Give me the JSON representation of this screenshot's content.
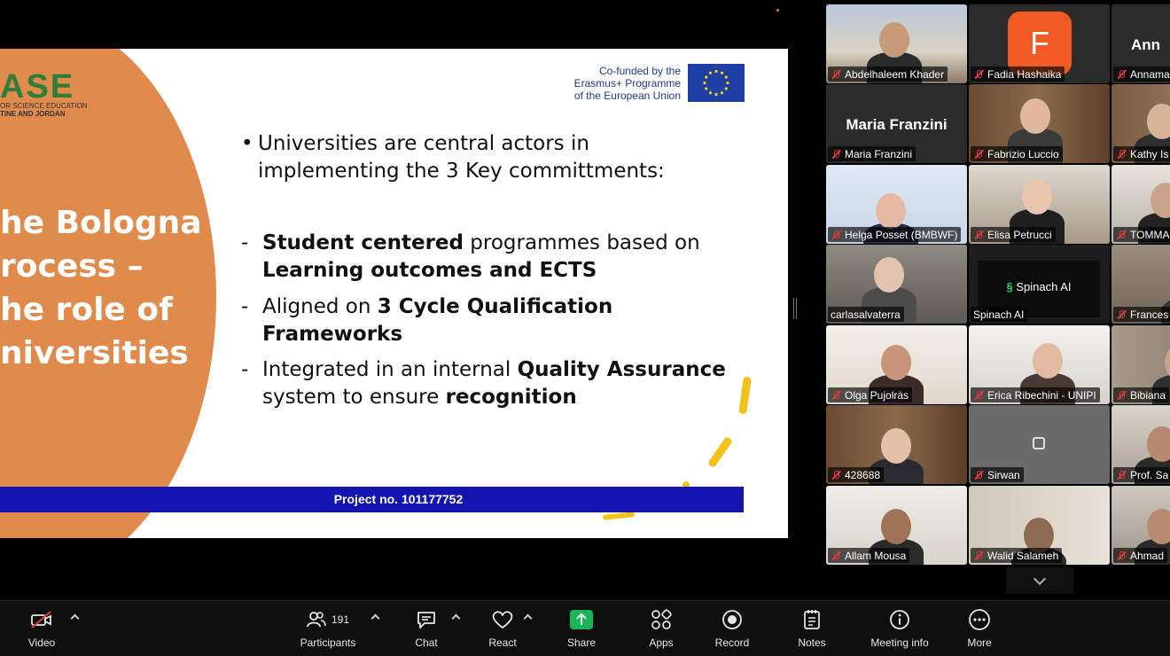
{
  "slide": {
    "logo_word": "ASE",
    "logo_line1": "OR SCIENCE EDUCATION",
    "logo_line2": "TINE AND JORDAN",
    "title": "he Bologna\nrocess –\nhe role of\nniversities",
    "eu_text": "Co-funded by the\nErasmus+ Programme\nof the European Union",
    "bullet_main": "Universities are central actors in implementing the 3 Key committments:",
    "sub_items": [
      {
        "parts": [
          [
            "b",
            "Student centered"
          ],
          [
            "",
            " programmes based on "
          ],
          [
            "b",
            "Learning outcomes and ECTS"
          ]
        ]
      },
      {
        "parts": [
          [
            "",
            "Aligned on "
          ],
          [
            "b",
            "3 Cycle Qualification Frameworks"
          ]
        ]
      },
      {
        "parts": [
          [
            "",
            "Integrated in an internal "
          ],
          [
            "b",
            "Quality Assurance"
          ],
          [
            "",
            " system to ensure "
          ],
          [
            "b",
            "recognition"
          ]
        ]
      }
    ],
    "bullet_symbol": "•",
    "dash_symbol": "-",
    "project": "Project no. 101177752"
  },
  "participants": [
    {
      "name": "Abdelhaleem Khader"
    },
    {
      "name": "Fadia Hashaika",
      "avatar_letter": "F"
    },
    {
      "name": "Annama",
      "center_name": "Ann"
    },
    {
      "name": "Maria Franzini",
      "center_name": "Maria Franzini"
    },
    {
      "name": "Fabrizio Luccio"
    },
    {
      "name": "Kathy Is"
    },
    {
      "name": "Helga Posset (BMBWF)"
    },
    {
      "name": "Elisa Petrucci"
    },
    {
      "name": "TOMMA"
    },
    {
      "name": "carlasalvaterra",
      "active": true
    },
    {
      "name": "Spinach AI",
      "screen_label": "Spinach AI"
    },
    {
      "name": "Frances"
    },
    {
      "name": "Olga Pujolràs"
    },
    {
      "name": "Erica Ribechini - UNIPI"
    },
    {
      "name": "Bibiana"
    },
    {
      "name": "428688"
    },
    {
      "name": "Sirwan"
    },
    {
      "name": "Prof. Sa"
    },
    {
      "name": "Allam Mousa"
    },
    {
      "name": "Walid Salameh"
    },
    {
      "name": "Ahmad"
    }
  ],
  "toolbar": {
    "video": "Video",
    "participants": "Participants",
    "participants_count": "191",
    "chat": "Chat",
    "react": "React",
    "share": "Share",
    "apps": "Apps",
    "record": "Record",
    "notes": "Notes",
    "meeting_info": "Meeting info",
    "more": "More"
  },
  "colors": {
    "accent_orange": "#e08a4b",
    "logo_green": "#2e7d3a",
    "project_blue": "#1414b0",
    "share_green": "#19b55a",
    "active_green": "#29c46a",
    "mute_red": "#e03b3b"
  }
}
